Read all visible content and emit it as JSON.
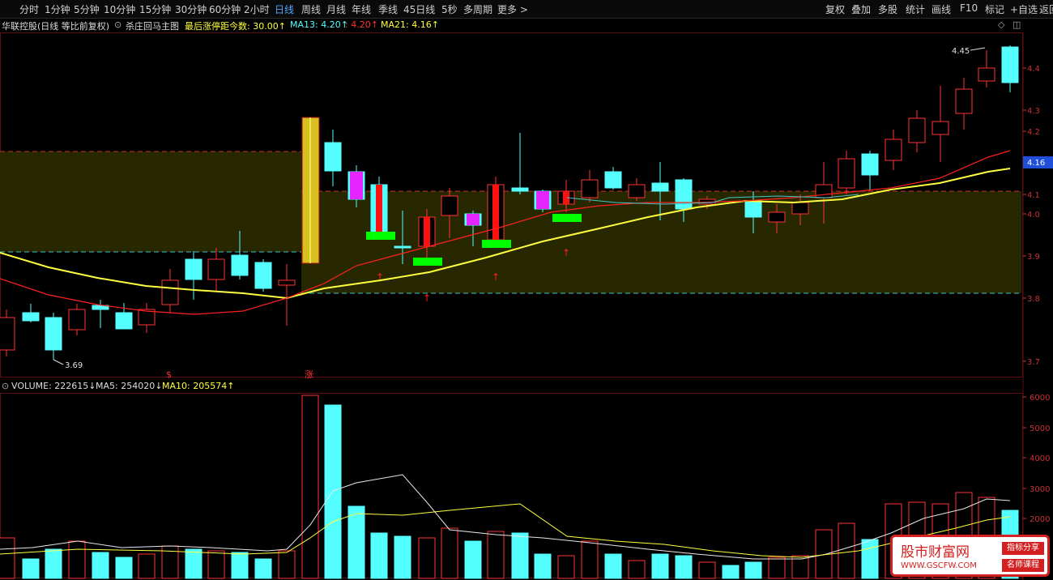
{
  "toolbar": {
    "periods": [
      "分时",
      "1分钟",
      "5分钟",
      "10分钟",
      "15分钟",
      "30分钟",
      "60分钟",
      "2小时",
      "日线",
      "周线",
      "月线",
      "年线",
      "季线",
      "45日线",
      "5秒",
      "多周期",
      "更多 >"
    ],
    "active_period": "日线",
    "right_tools": [
      "复权",
      "叠加",
      "多股",
      "统计",
      "画线",
      "F10",
      "标记",
      "+自选",
      "返回"
    ]
  },
  "info_bar": {
    "stock": "华联控股(日线 等比前复权)",
    "indicator": "杀庄回马主图",
    "limit_label": "最后涨停距今数: 30.00↑",
    "ma13": "MA13: 4.20↑",
    "ma_mid": ": 4.20↑",
    "ma21": "MA21: 4.16↑"
  },
  "volume_bar": {
    "volume": "VOLUME: 222615↓",
    "ma5": "MA5: 254020↓",
    "ma10": "MA10: 205574↑"
  },
  "price_axis": {
    "ticks": [
      "4.4",
      "4.3",
      "4.2",
      "4.1",
      "4.0",
      "3.9",
      "3.8",
      "3.7"
    ],
    "current": "4.16"
  },
  "volume_axis": {
    "ticks": [
      "6000",
      "5000",
      "4000",
      "3000",
      "2000"
    ]
  },
  "annotations": {
    "high_label": "4.45",
    "low_label": "3.69",
    "marker_s": "$",
    "marker_zhang": "涨"
  },
  "colors": {
    "up": "#ff3232",
    "down": "#54ffff",
    "ma_yellow": "#ffff40",
    "ma_red": "#ff2020",
    "ma_cyan": "#40c8c8",
    "zone": "#2a2a00",
    "signal_green": "#00ff00",
    "signal_magenta": "#ff00ff"
  },
  "watermark": {
    "title": "股市财富网",
    "url": "WWW.GSCFW.COM",
    "badge1": "指标分享",
    "badge2": "名师课程"
  }
}
